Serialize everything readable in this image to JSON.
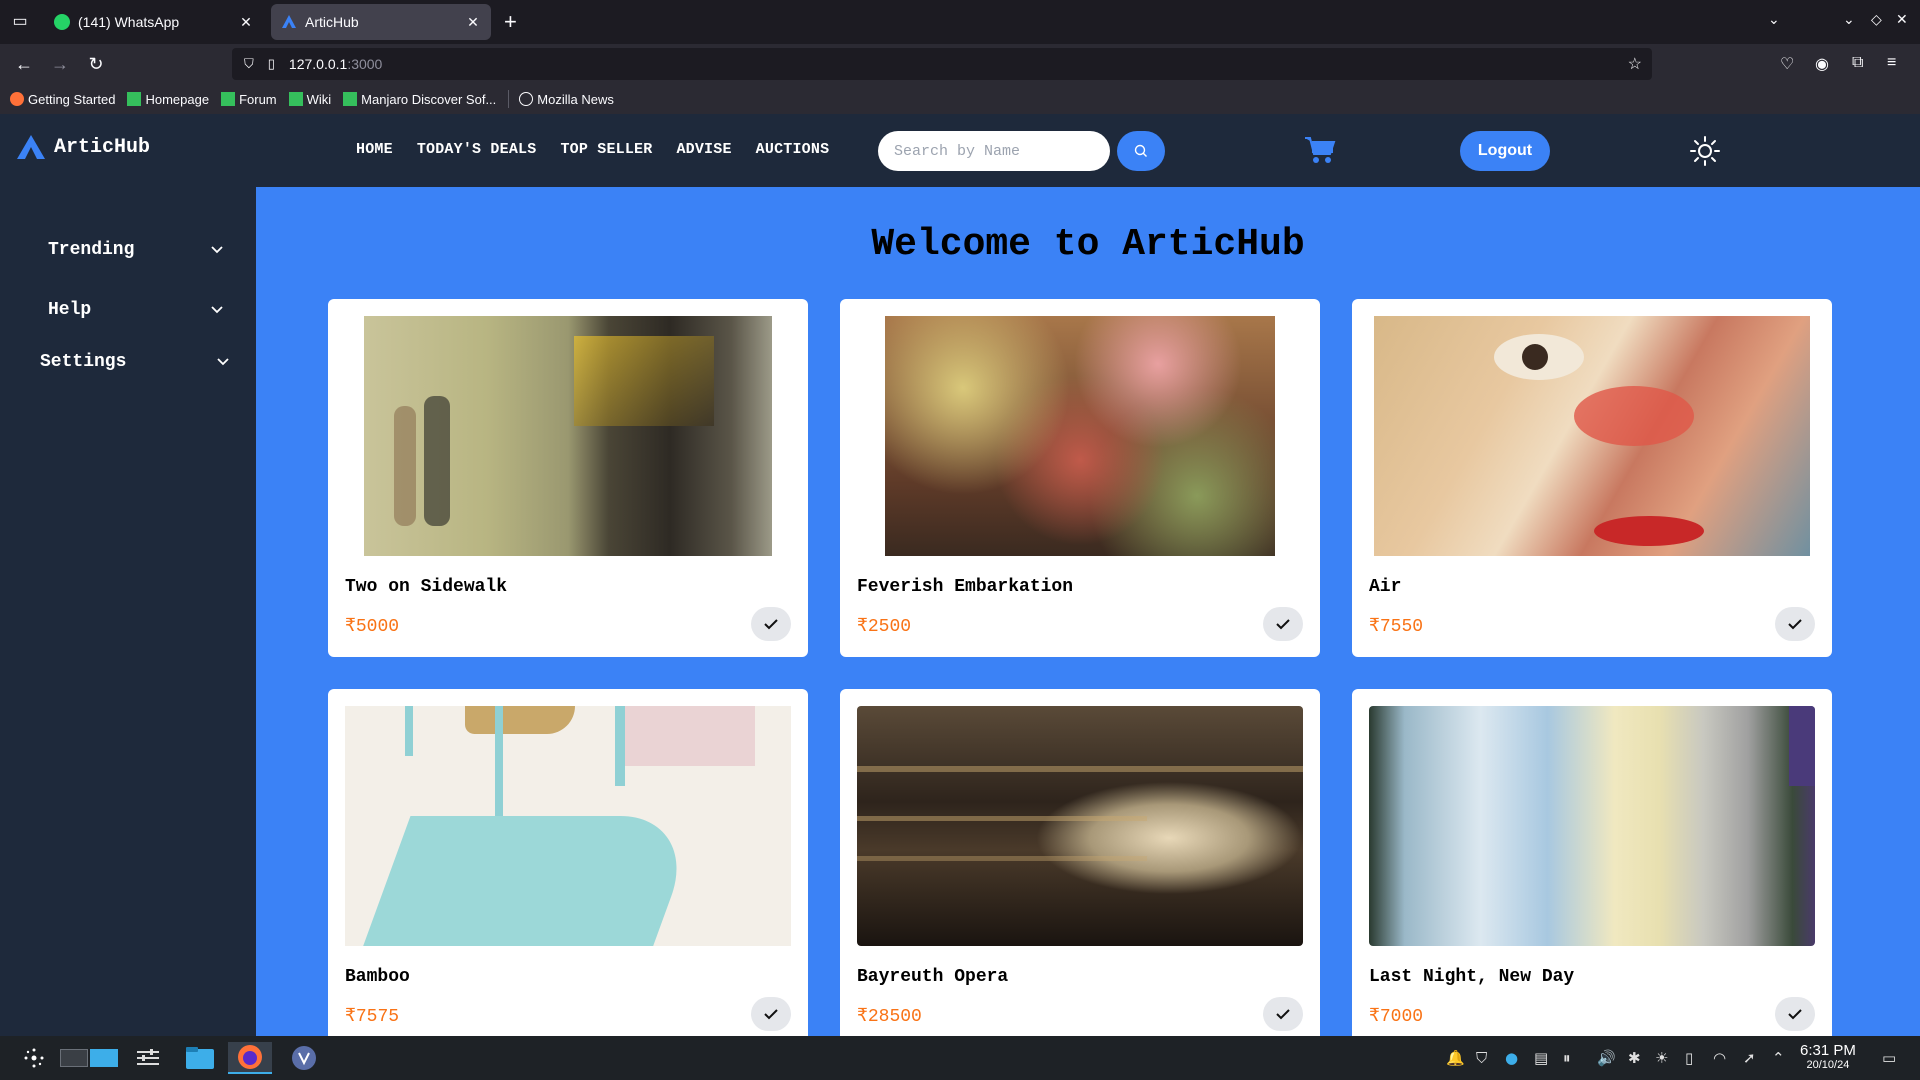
{
  "browser": {
    "tabs": [
      {
        "title": "(141) WhatsApp",
        "active": false
      },
      {
        "title": "ArticHub",
        "active": true
      }
    ],
    "url_host": "127.0.0.1",
    "url_port": ":3000",
    "bookmarks": [
      "Getting Started",
      "Homepage",
      "Forum",
      "Wiki",
      "Manjaro Discover Sof...",
      "Mozilla News"
    ]
  },
  "app": {
    "logo_text": "ArticHub",
    "nav": [
      "HOME",
      "TODAY'S DEALS",
      "TOP SELLER",
      "ADVISE",
      "AUCTIONS"
    ],
    "search_placeholder": "Search by Name",
    "logout_label": "Logout",
    "sidebar": [
      "Trending",
      "Help",
      "Settings"
    ],
    "welcome": "Welcome to ArticHub",
    "products": [
      {
        "name": "Two on Sidewalk",
        "price": "₹5000"
      },
      {
        "name": "Feverish Embarkation",
        "price": "₹2500"
      },
      {
        "name": "Air",
        "price": "₹7550"
      },
      {
        "name": "Bamboo",
        "price": "₹7575"
      },
      {
        "name": "Bayreuth Opera",
        "price": "₹28500"
      },
      {
        "name": "Last Night, New Day",
        "price": "₹7000"
      }
    ],
    "colors": {
      "accent": "#3b82f6",
      "price": "#f97316",
      "header": "#1e293b"
    }
  },
  "taskbar": {
    "time": "6:31 PM",
    "date": "20/10/24"
  }
}
